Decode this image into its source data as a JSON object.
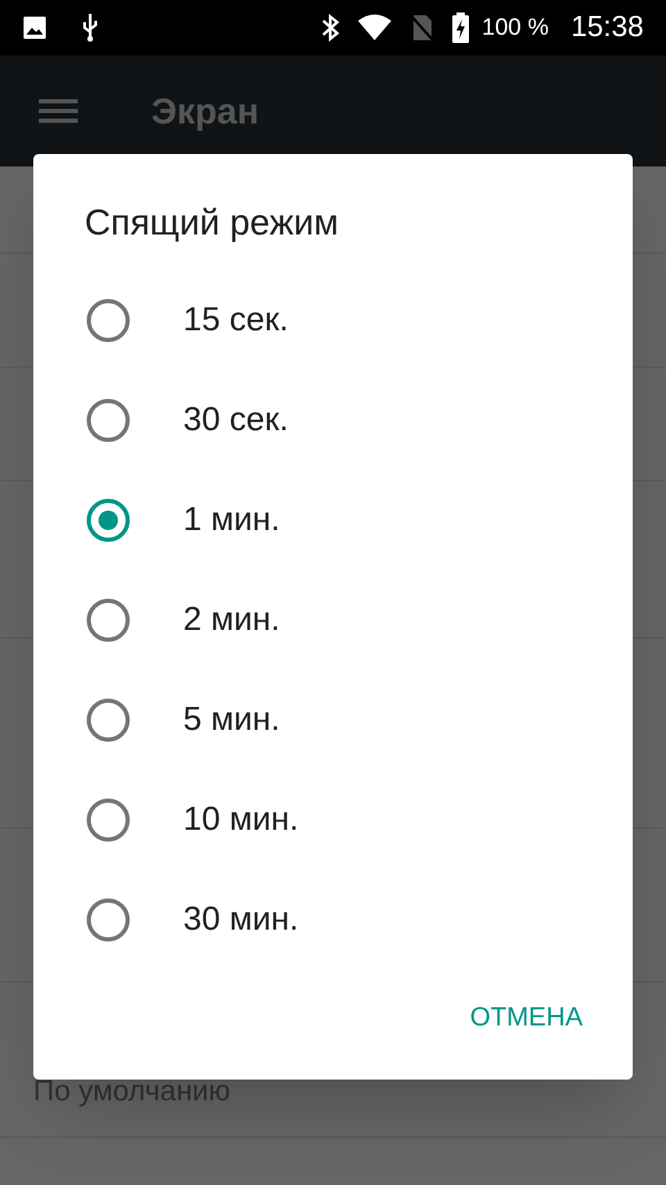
{
  "status_bar": {
    "battery": "100 %",
    "time": "15:38"
  },
  "app_bar": {
    "title": "Экран"
  },
  "background": {
    "visible_text": "По умолчанию"
  },
  "dialog": {
    "title": "Спящий режим",
    "options": [
      {
        "label": "15 сек.",
        "selected": false
      },
      {
        "label": "30 сек.",
        "selected": false
      },
      {
        "label": "1 мин.",
        "selected": true
      },
      {
        "label": "2 мин.",
        "selected": false
      },
      {
        "label": "5 мин.",
        "selected": false
      },
      {
        "label": "10 мин.",
        "selected": false
      },
      {
        "label": "30 мин.",
        "selected": false
      }
    ],
    "button": "ОТМЕНА"
  }
}
